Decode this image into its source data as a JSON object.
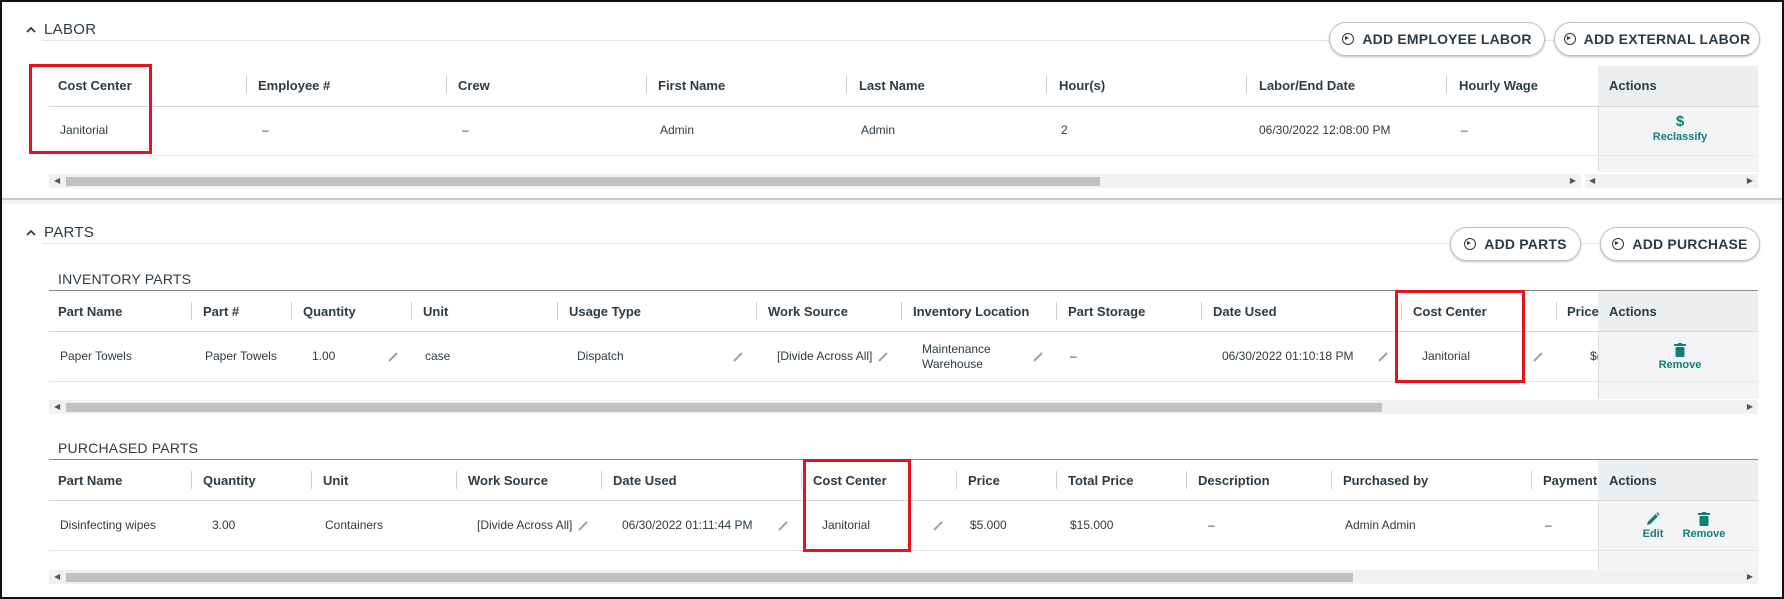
{
  "labor": {
    "title": "LABOR",
    "add_employee_label": "ADD EMPLOYEE LABOR",
    "add_external_label": "ADD EXTERNAL LABOR",
    "headers": [
      "Cost Center",
      "Employee #",
      "Crew",
      "First Name",
      "Last Name",
      "Hour(s)",
      "Labor/End Date",
      "Hourly Wage"
    ],
    "actions_header": "Actions",
    "row": [
      "Janitorial",
      "–",
      "–",
      "Admin",
      "Admin",
      "2",
      "06/30/2022 12:08:00 PM",
      "–"
    ],
    "reclassify_label": "Reclassify"
  },
  "parts": {
    "title": "PARTS",
    "add_parts_label": "ADD PARTS",
    "add_purchase_label": "ADD PURCHASE",
    "inventory": {
      "title": "INVENTORY PARTS",
      "headers": [
        "Part Name",
        "Part #",
        "Quantity",
        "Unit",
        "Usage Type",
        "Work Source",
        "Inventory Location",
        "Part Storage",
        "Date Used",
        "Cost Center",
        "Price"
      ],
      "actions_header": "Actions",
      "row": {
        "part_name": "Paper Towels",
        "part_no": "Paper Towels",
        "quantity": "1.00",
        "unit": "case",
        "usage_type": "Dispatch",
        "work_source": "[Divide Across All]",
        "inventory_location_1": "Maintenance",
        "inventory_location_2": "Warehouse",
        "part_storage": "–",
        "date_used": "06/30/2022 01:10:18 PM",
        "cost_center": "Janitorial",
        "price": "$("
      },
      "remove_label": "Remove"
    },
    "purchased": {
      "title": "PURCHASED PARTS",
      "headers": [
        "Part Name",
        "Quantity",
        "Unit",
        "Work Source",
        "Date Used",
        "Cost Center",
        "Price",
        "Total Price",
        "Description",
        "Purchased by",
        "Payment"
      ],
      "actions_header": "Actions",
      "row": {
        "part_name": "Disinfecting wipes",
        "quantity": "3.00",
        "unit": "Containers",
        "work_source": "[Divide Across All]",
        "date_used": "06/30/2022 01:11:44 PM",
        "cost_center": "Janitorial",
        "price": "$5.000",
        "total_price": "$15.000",
        "description": "–",
        "purchased_by": "Admin Admin",
        "payment": "–"
      },
      "edit_label": "Edit",
      "remove_label": "Remove"
    }
  },
  "colors": {
    "accent": "#127e76",
    "highlight": "#e8121c"
  }
}
